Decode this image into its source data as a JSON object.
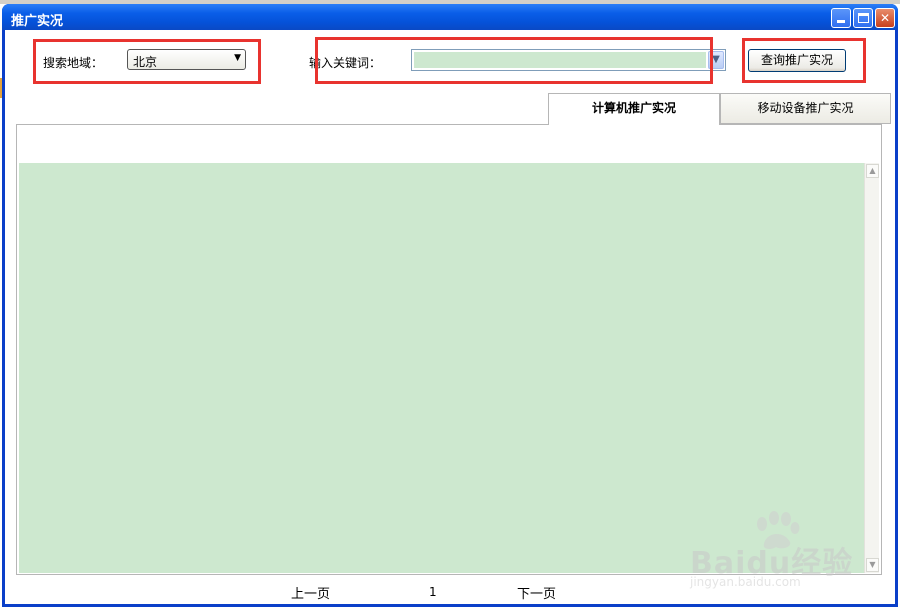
{
  "window": {
    "title": "推广实况"
  },
  "filters": {
    "region_label": "搜索地域：",
    "region_value": "北京",
    "keyword_label": "输入关键词：",
    "keyword_value": "",
    "query_button": "查询推广实况"
  },
  "tabs": [
    {
      "label": "计算机推广实况",
      "active": true
    },
    {
      "label": "移动设备推广实况",
      "active": false
    }
  ],
  "pager": {
    "prev": "上一页",
    "page": "1",
    "next": "下一页"
  },
  "watermark": {
    "brand": "Baidu经验",
    "url": "jingyan.baidu.com"
  },
  "colors": {
    "highlight": "#e8332f",
    "grid_fill": "#cde8cf",
    "titlebar": "#0552d9"
  }
}
